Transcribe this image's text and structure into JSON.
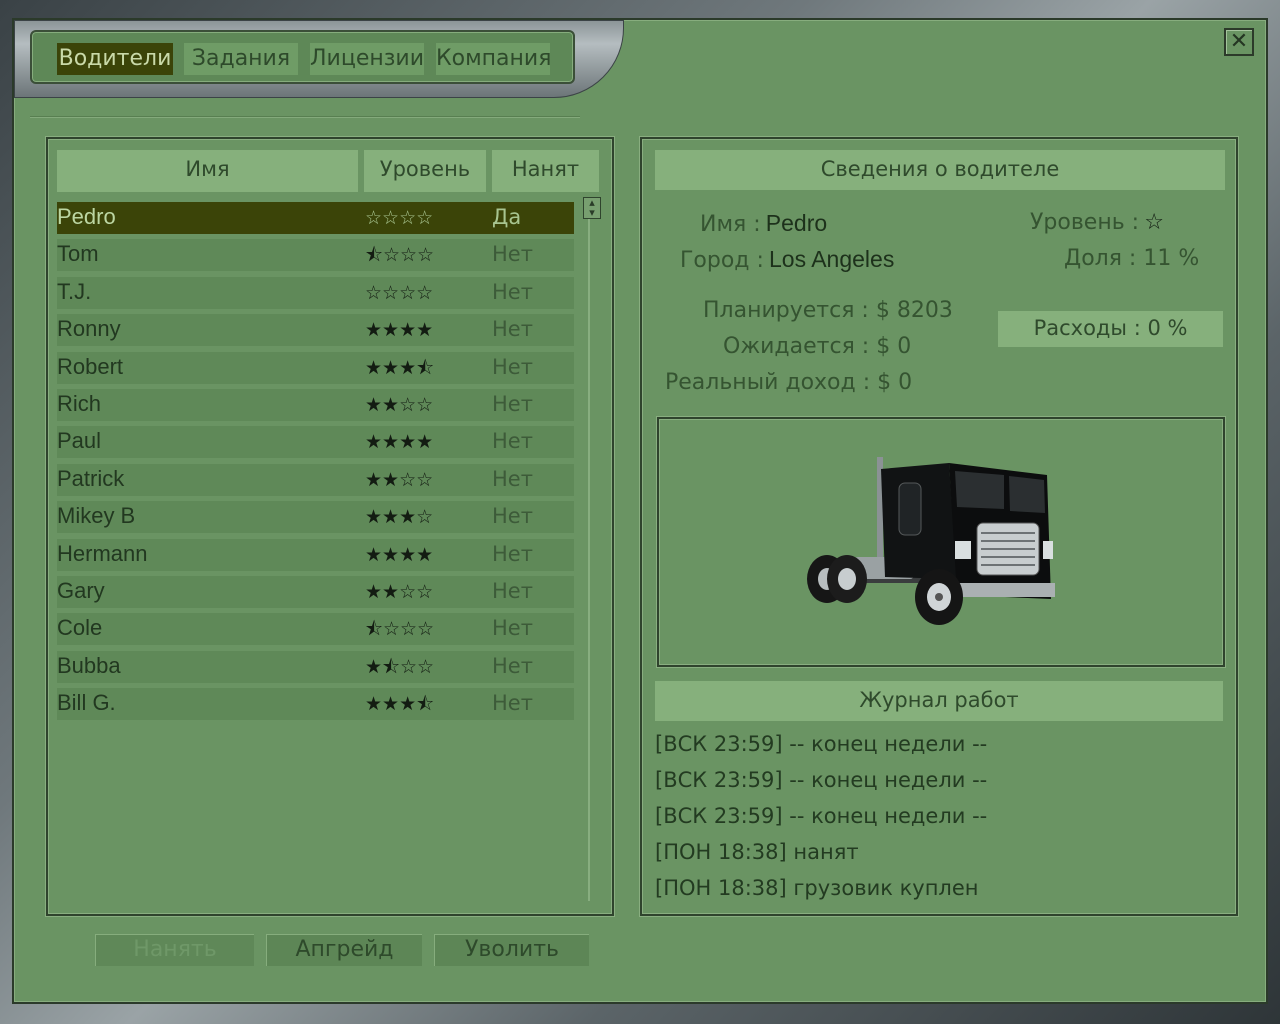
{
  "tabs": [
    {
      "label": "Водители",
      "active": true
    },
    {
      "label": "Задания",
      "active": false
    },
    {
      "label": "Лицензии",
      "active": false
    },
    {
      "label": "Компания",
      "active": false
    }
  ],
  "close_icon": "close-icon",
  "drivers_table": {
    "headers": {
      "name": "Имя",
      "level": "Уровень",
      "hired": "Нанят"
    },
    "rows": [
      {
        "name": "Pedro",
        "level": "☆☆☆☆",
        "hired": "Да",
        "selected": true
      },
      {
        "name": "Tom",
        "level": "⯪☆☆☆",
        "hired": "Нет"
      },
      {
        "name": "T.J.",
        "level": "☆☆☆☆",
        "hired": "Нет"
      },
      {
        "name": "Ronny",
        "level": "★★★★",
        "hired": "Нет"
      },
      {
        "name": "Robert",
        "level": "★★★⯪",
        "hired": "Нет"
      },
      {
        "name": "Rich",
        "level": "★★☆☆",
        "hired": "Нет"
      },
      {
        "name": "Paul",
        "level": "★★★★",
        "hired": "Нет"
      },
      {
        "name": "Patrick",
        "level": "★★☆☆",
        "hired": "Нет"
      },
      {
        "name": "Mikey B",
        "level": "★★★☆",
        "hired": "Нет"
      },
      {
        "name": "Hermann",
        "level": "★★★★",
        "hired": "Нет"
      },
      {
        "name": "Gary",
        "level": "★★☆☆",
        "hired": "Нет"
      },
      {
        "name": "Cole",
        "level": "⯪☆☆☆",
        "hired": "Нет"
      },
      {
        "name": "Bubba",
        "level": "★⯪☆☆",
        "hired": "Нет"
      },
      {
        "name": "Bill G.",
        "level": "★★★⯪",
        "hired": "Нет"
      }
    ]
  },
  "buttons": {
    "hire": "Нанять",
    "upgrade": "Апгрейд",
    "fire": "Уволить"
  },
  "details": {
    "title": "Сведения о водителе",
    "name_label": "Имя :",
    "name_value": "Pedro",
    "city_label": "Город :",
    "city_value": "Los Angeles",
    "level_label": "Уровень :",
    "level_value": "☆",
    "share_label": "Доля : 11 %",
    "planned": "Планируется : $ 8203",
    "expected": "Ожидается : $ 0",
    "real_income": "Реальный доход : $ 0",
    "expenses": "Расходы : 0 %"
  },
  "journal": {
    "title": "Журнал работ",
    "entries": [
      {
        "time": "[ВСК 23:59]",
        "text": "-- конец недели --"
      },
      {
        "time": "[ВСК 23:59]",
        "text": "-- конец недели --"
      },
      {
        "time": "[ВСК 23:59]",
        "text": "-- конец недели --"
      },
      {
        "time": "[ПОН 18:38]",
        "text": "нанят"
      },
      {
        "time": "[ПОН 18:38]",
        "text": "грузовик куплен"
      }
    ]
  },
  "colors": {
    "panel": "#6a9463",
    "header": "#86b07c",
    "selected": "#3b4408"
  }
}
